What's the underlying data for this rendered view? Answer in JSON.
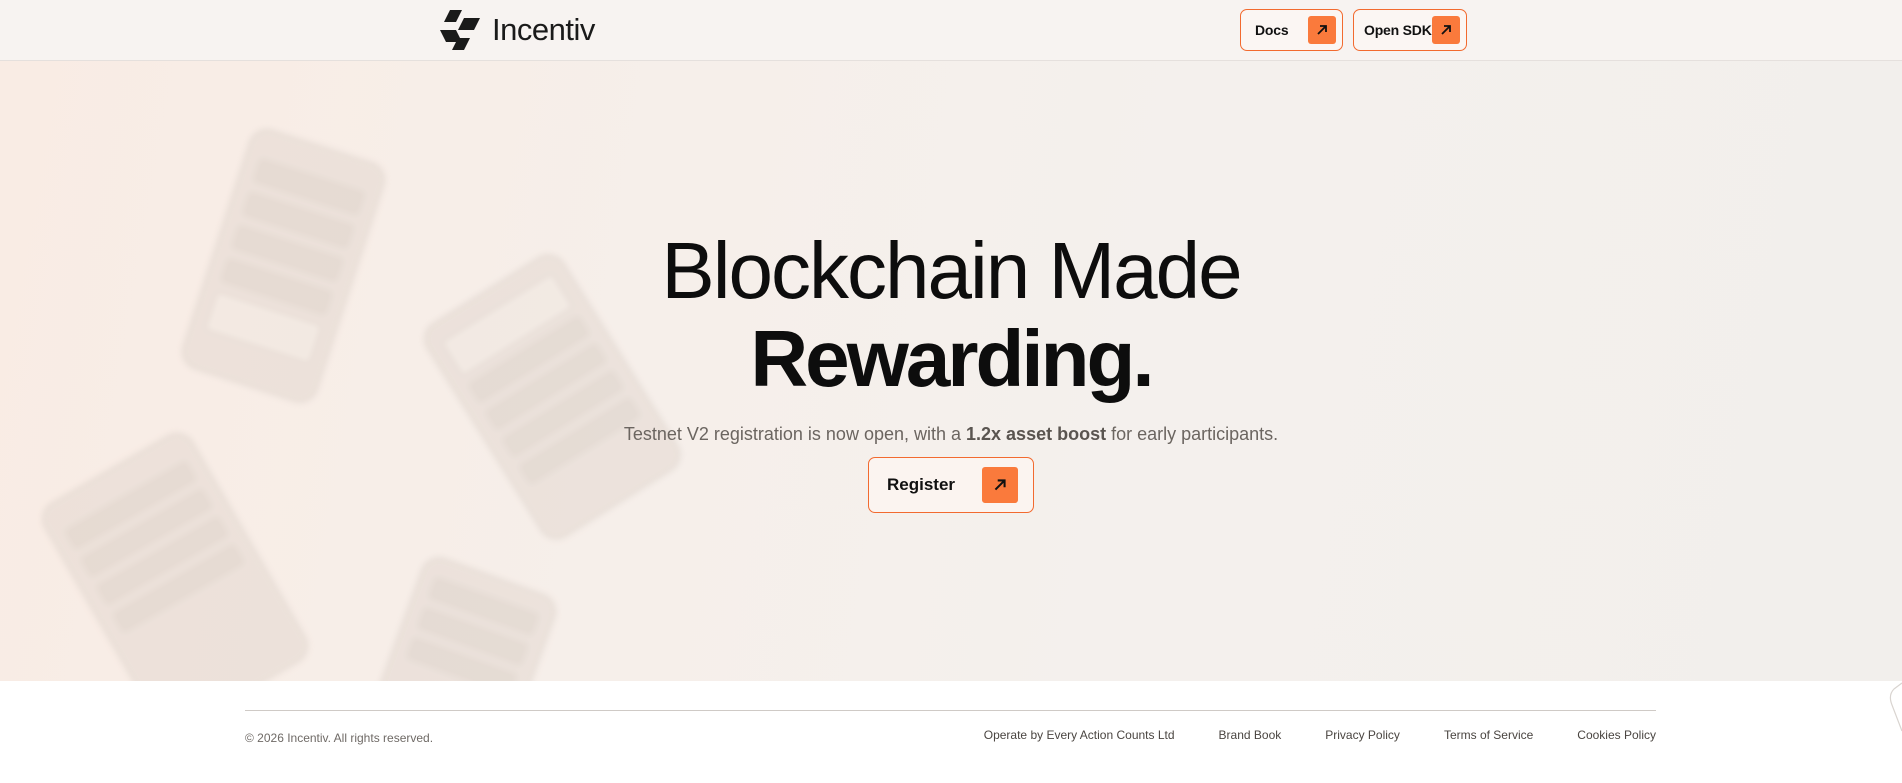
{
  "header": {
    "logo_text": "Incentiv",
    "logo_icon": "incentiv-logo-mark",
    "docs_label": "Docs",
    "sdk_label": "Open SDK",
    "arrow_icon": "arrow-up-right-icon"
  },
  "hero": {
    "headline_line1": "Blockchain Made",
    "headline_line2": "Rewarding.",
    "subline_before": "Testnet V2 registration is now open, with a ",
    "subline_bold": "1.2x asset boost",
    "subline_after": " for early participants.",
    "register_label": "Register"
  },
  "footer": {
    "copyright": "© 2026 Incentiv. All rights reserved.",
    "links": [
      "Operate by Every Action Counts Ltd",
      "Brand Book",
      "Privacy Policy",
      "Terms of Service",
      "Cookies Policy"
    ]
  },
  "colors": {
    "accent": "#fa7a3c",
    "accent_border": "#f26a2f",
    "header_bg": "#f7f3f1",
    "hero_bg": "#f6efea",
    "text": "#0d0d0d"
  }
}
